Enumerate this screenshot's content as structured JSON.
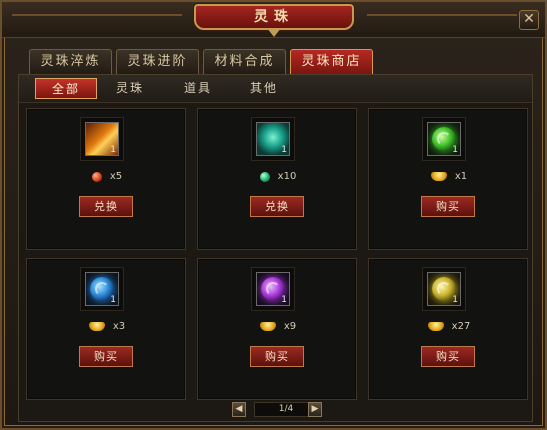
{
  "window": {
    "title": "灵珠",
    "close_icon": "close-icon"
  },
  "tabs": [
    {
      "label": "灵珠淬炼",
      "active": false
    },
    {
      "label": "灵珠进阶",
      "active": false
    },
    {
      "label": "材料合成",
      "active": false
    },
    {
      "label": "灵珠商店",
      "active": true
    }
  ],
  "subtabs": [
    {
      "label": "全部",
      "active": true
    },
    {
      "label": "灵珠",
      "active": false
    },
    {
      "label": "道具",
      "active": false
    },
    {
      "label": "其他",
      "active": false
    }
  ],
  "items": [
    {
      "icon": "fire-scroll-icon",
      "count": "1",
      "currency": "red-coin",
      "price": "x5",
      "button": "兑换"
    },
    {
      "icon": "teal-whirlwind-icon",
      "count": "1",
      "currency": "green-coin",
      "price": "x10",
      "button": "兑换"
    },
    {
      "icon": "green-pearl-icon",
      "count": "1",
      "currency": "gold-ingot",
      "price": "x1",
      "button": "购买"
    },
    {
      "icon": "blue-pearl-icon",
      "count": "1",
      "currency": "gold-ingot",
      "price": "x3",
      "button": "购买"
    },
    {
      "icon": "purple-pearl-icon",
      "count": "1",
      "currency": "gold-ingot",
      "price": "x9",
      "button": "购买"
    },
    {
      "icon": "yellow-pearl-icon",
      "count": "1",
      "currency": "gold-ingot",
      "price": "x27",
      "button": "购买"
    }
  ],
  "pager": {
    "prev_icon": "arrow-left-icon",
    "next_icon": "arrow-right-icon",
    "label": "1/4"
  },
  "colors": {
    "accent_red": "#b52a22",
    "frame_gold": "#c59a52"
  }
}
